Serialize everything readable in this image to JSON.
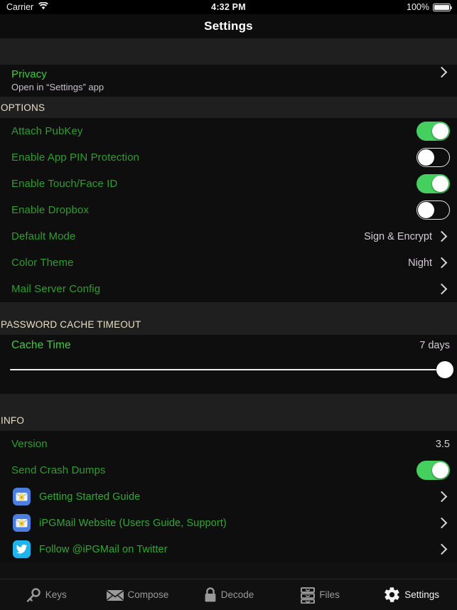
{
  "status_bar": {
    "carrier": "Carrier",
    "wifi_icon": "wifi-icon",
    "time": "4:32 PM",
    "battery_percent": "100%",
    "battery_icon": "battery-full-icon"
  },
  "nav": {
    "title": "Settings"
  },
  "privacy_section": {
    "row": {
      "label": "Privacy",
      "subtitle": "Open in “Settings” app",
      "chevron": "chevron-right-icon"
    }
  },
  "options_section": {
    "header": "OPTIONS",
    "rows": [
      {
        "label": "Attach PubKey",
        "type": "toggle",
        "value": "on"
      },
      {
        "label": "Enable App PIN Protection",
        "type": "toggle",
        "value": "off"
      },
      {
        "label": "Enable Touch/Face ID",
        "type": "toggle",
        "value": "on"
      },
      {
        "label": "Enable Dropbox",
        "type": "toggle",
        "value": "off"
      },
      {
        "label": "Default Mode",
        "type": "disclosure",
        "value": "Sign & Encrypt"
      },
      {
        "label": "Color Theme",
        "type": "disclosure",
        "value": "Night"
      },
      {
        "label": "Mail Server Config",
        "type": "disclosure",
        "value": ""
      }
    ]
  },
  "cache_section": {
    "header": "PASSWORD CACHE TIMEOUT",
    "label": "Cache Time",
    "value": "7 days",
    "slider": {
      "name": "cache-time-slider",
      "percent": 100
    }
  },
  "info_section": {
    "header": "INFO",
    "version": {
      "label": "Version",
      "value": "3.5"
    },
    "crash_dumps": {
      "label": "Send Crash Dumps",
      "value": "on"
    },
    "links": [
      {
        "label": "Getting Started Guide",
        "icon": "ipgmail-app-icon"
      },
      {
        "label": "iPGMail Website (Users Guide, Support)",
        "icon": "ipgmail-app-icon"
      },
      {
        "label": "Follow @iPGMail on Twitter",
        "icon": "twitter-icon"
      }
    ]
  },
  "tab_bar": {
    "tabs": [
      {
        "label": "Keys",
        "icon": "key-icon",
        "active": false
      },
      {
        "label": "Compose",
        "icon": "envelope-icon",
        "active": false
      },
      {
        "label": "Decode",
        "icon": "lock-icon",
        "active": false
      },
      {
        "label": "Files",
        "icon": "files-icon",
        "active": false
      },
      {
        "label": "Settings",
        "icon": "gear-icon",
        "active": true
      }
    ]
  },
  "colors": {
    "accent_green": "#2c9d2e",
    "bright_green": "#3ccb3e",
    "toggle_on": "#45cf5e",
    "section_header": "#e9dfc6",
    "value_text": "#d4cbd6",
    "background": "#111111",
    "row_background": "#0e0e0e"
  }
}
